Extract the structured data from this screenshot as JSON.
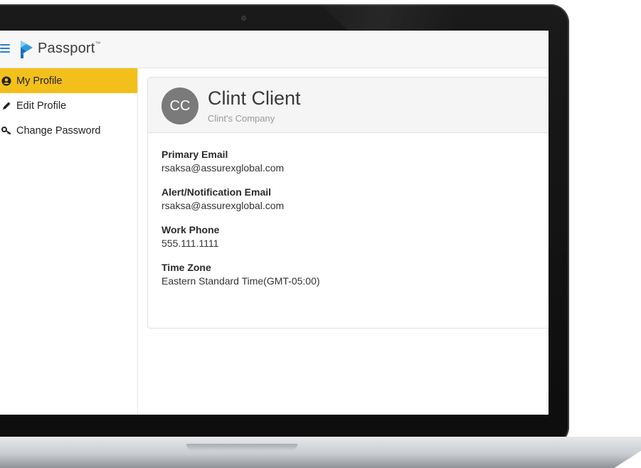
{
  "app": {
    "brand": "Passport",
    "brand_mark": "™"
  },
  "sidebar": {
    "items": [
      {
        "label": "My Profile",
        "icon": "user-circle-icon",
        "active": true
      },
      {
        "label": "Edit Profile",
        "icon": "pencil-icon",
        "active": false
      },
      {
        "label": "Change Password",
        "icon": "key-icon",
        "active": false
      }
    ]
  },
  "profile": {
    "initials": "CC",
    "name": "Clint Client",
    "company": "Clint's Company",
    "fields": [
      {
        "label": "Primary Email",
        "value": "rsaksa@assurexglobal.com"
      },
      {
        "label": "Alert/Notification Email",
        "value": "rsaksa@assurexglobal.com"
      },
      {
        "label": "Work Phone",
        "value": "555.111.1111"
      },
      {
        "label": "Time Zone",
        "value": "Eastern Standard Time(GMT-05:00)"
      }
    ]
  },
  "colors": {
    "accent": "#f3c01b",
    "brand_blue": "#2d7fc6",
    "avatar_bg": "#7a7a7a"
  }
}
